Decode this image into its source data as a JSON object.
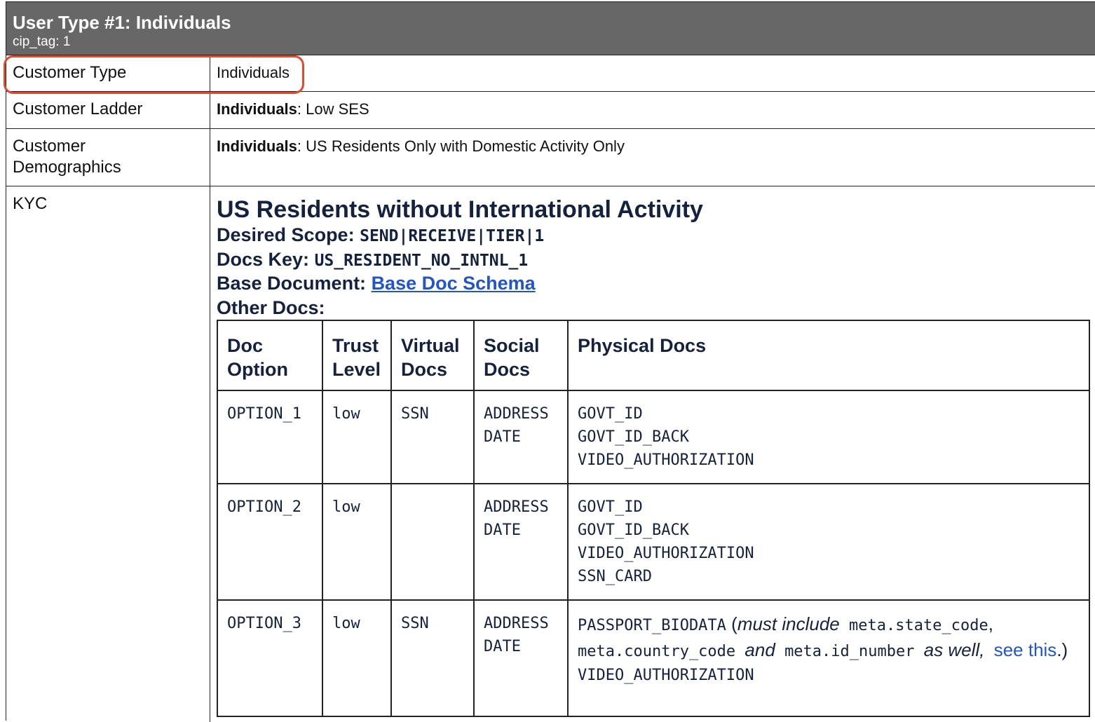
{
  "header": {
    "title": "User Type #1: Individuals",
    "subtitle": "cip_tag: 1"
  },
  "rows": [
    {
      "label": "Customer Type",
      "value": "Individuals"
    },
    {
      "label": "Customer Ladder",
      "value_bold": "Individuals",
      "value_rest": ": Low SES"
    },
    {
      "label_line1": "Customer",
      "label_line2": "Demographics",
      "value_bold": "Individuals",
      "value_rest": ": US Residents Only with Domestic Activity Only"
    },
    {
      "label": "KYC"
    }
  ],
  "kyc": {
    "heading": "US Residents without International Activity",
    "scope_label": "Desired Scope:",
    "scope_value": "SEND|RECEIVE|TIER|1",
    "docs_key_label": "Docs Key:",
    "docs_key_value": "US_RESIDENT_NO_INTNL_1",
    "base_doc_label": "Base Document:",
    "base_doc_link": "Base Doc Schema",
    "other_docs_label": "Other Docs:",
    "table": {
      "headers": [
        {
          "l1": "Doc",
          "l2": "Option"
        },
        {
          "l1": "Trust",
          "l2": "Level"
        },
        {
          "l1": "Virtual",
          "l2": "Docs"
        },
        {
          "l1": "Social",
          "l2": "Docs"
        },
        {
          "l1": "Physical Docs",
          "l2": ""
        }
      ],
      "rows": [
        {
          "option": "OPTION_1",
          "trust": "low",
          "virtual": "SSN",
          "social": [
            "ADDRESS",
            "DATE"
          ],
          "physical": [
            "GOVT_ID",
            "GOVT_ID_BACK",
            "VIDEO_AUTHORIZATION"
          ]
        },
        {
          "option": "OPTION_2",
          "trust": "low",
          "virtual": "",
          "social": [
            "ADDRESS",
            "DATE"
          ],
          "physical": [
            "GOVT_ID",
            "GOVT_ID_BACK",
            "VIDEO_AUTHORIZATION",
            "SSN_CARD"
          ]
        },
        {
          "option": "OPTION_3",
          "trust": "low",
          "virtual": "SSN",
          "social": [
            "ADDRESS",
            "DATE"
          ],
          "physical_rich": {
            "code1": "PASSPORT_BIODATA",
            "t1": " (",
            "i1": "must include",
            "code2": "meta.state_code",
            "t2": ",",
            "code3": "meta.country_code",
            "i2": "and",
            "code4": "meta.id_number",
            "i3": "as well,",
            "link": "see this",
            "t3": ".)",
            "code5": "VIDEO_AUTHORIZATION"
          }
        }
      ]
    }
  }
}
